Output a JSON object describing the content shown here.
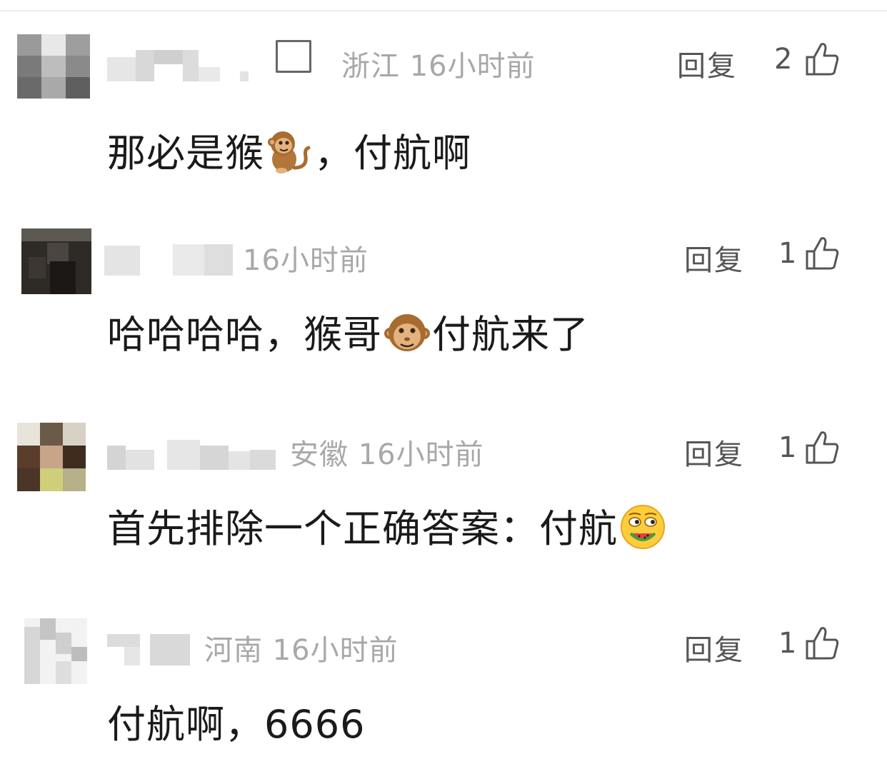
{
  "comments": [
    {
      "location_time": "浙江 16小时前",
      "reply_label": "回复",
      "likes": "2",
      "text_before": "那必是猴",
      "emoji1": "monkey-icon",
      "text_after": "，付航啊"
    },
    {
      "location_time": "16小时前",
      "reply_label": "回复",
      "likes": "1",
      "text_before": "哈哈哈哈，猴哥",
      "emoji1": "monkey-face-icon",
      "text_after": "付航来了"
    },
    {
      "location_time": "安徽 16小时前",
      "reply_label": "回复",
      "likes": "1",
      "text_before": "首先排除一个正确答案：付航",
      "emoji1": "eating-watermelon-icon",
      "text_after": ""
    },
    {
      "location_time": "河南 16小时前",
      "reply_label": "回复",
      "likes": "1",
      "text_before": "付航啊，6666",
      "text_after": ""
    }
  ],
  "colors": {
    "meta": "#a8a8a8",
    "text": "#1a1a1a",
    "action": "#555555"
  }
}
